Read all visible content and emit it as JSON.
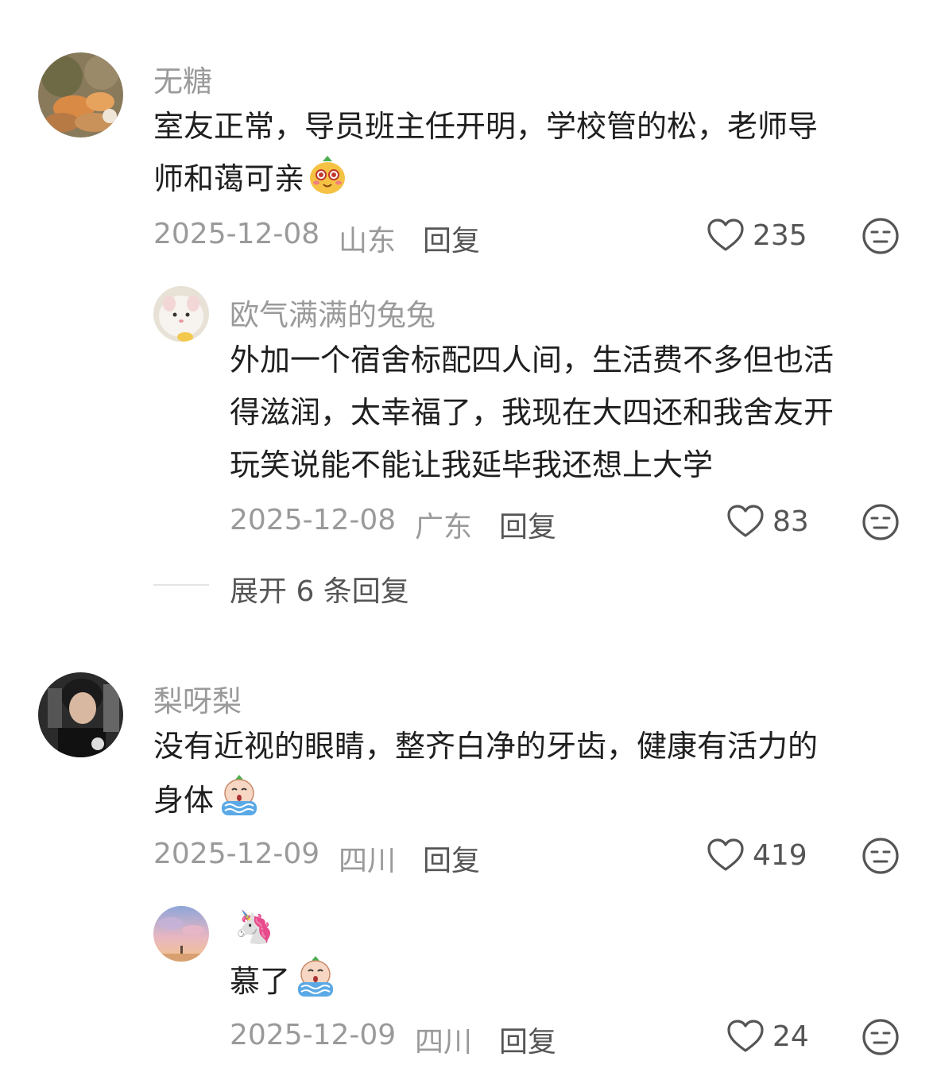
{
  "comments": [
    {
      "username": "无糖",
      "text_line1": "室友正常，导员班主任开明，学校管的松，老师导",
      "text_line2": "师和蔼可亲",
      "date": "2025-12-08",
      "location": "山东",
      "reply_label": "回复",
      "likes": "235",
      "reply": {
        "username": "欧气满满的兔兔",
        "text_line1": "外加一个宿舍标配四人间，生活费不多但也活",
        "text_line2": "得滋润，太幸福了，我现在大四还和我舍友开",
        "text_line3": "玩笑说能不能让我延毕我还想上大学",
        "date": "2025-12-08",
        "location": "广东",
        "reply_label": "回复",
        "likes": "83"
      },
      "expand_label": "展开 6 条回复"
    },
    {
      "username": "梨呀梨",
      "text_line1": "没有近视的眼睛，整齐白净的牙齿，健康有活力的",
      "text_line2": "身体",
      "date": "2025-12-09",
      "location": "四川",
      "reply_label": "回复",
      "likes": "419",
      "reply": {
        "username": "🦄",
        "text_line1": "慕了",
        "date": "2025-12-09",
        "location": "四川",
        "reply_label": "回复",
        "likes": "24"
      }
    }
  ],
  "icons": {
    "like": "heart-outline-icon",
    "dislike": "meh-face-icon",
    "emoji_happy": "pear-smile-emoji",
    "emoji_cry": "crying-emoji"
  },
  "colors": {
    "text": "#1f1f1f",
    "secondary": "#9a9a9a",
    "action": "#555555"
  }
}
